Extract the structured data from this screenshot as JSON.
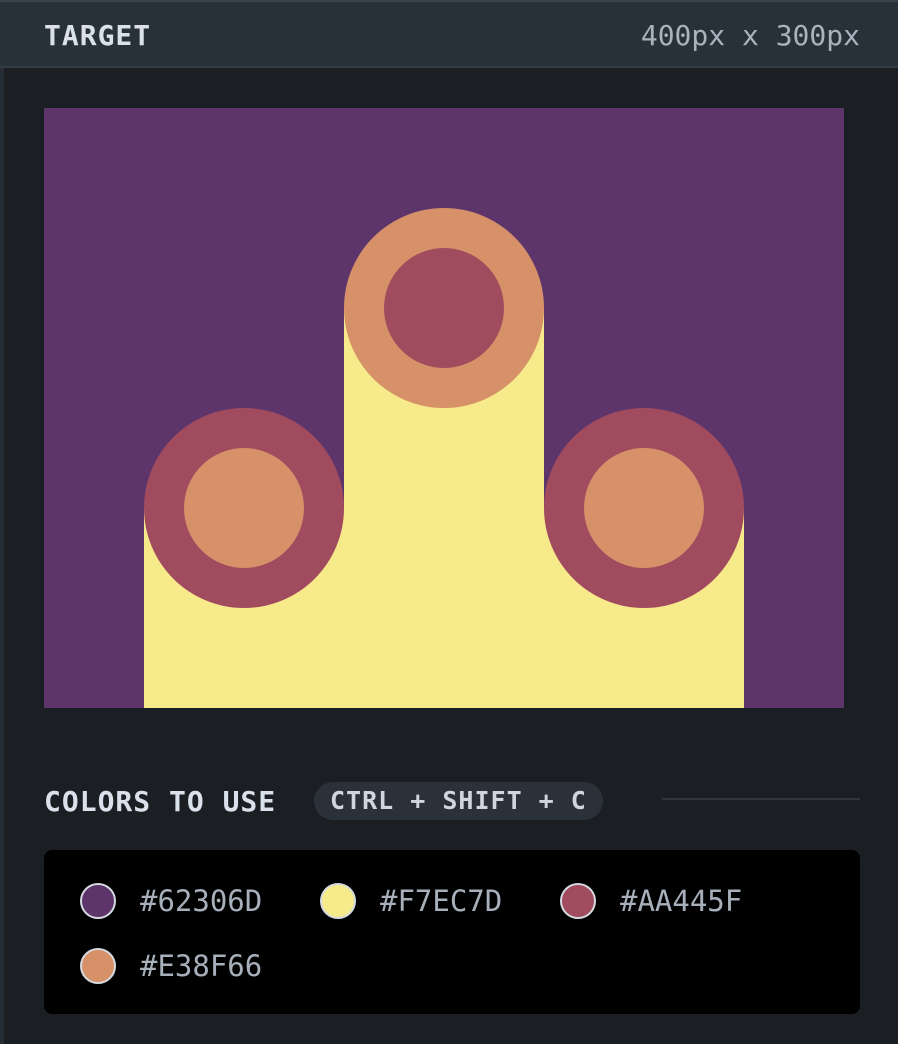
{
  "header": {
    "title": "TARGET",
    "size_label": "400px x 300px"
  },
  "target": {
    "background": "#5d356a",
    "shapes": {
      "pillar_color": "#f7ea8a",
      "outer_ring_color": "#d79168",
      "inner_center_color": "#a14b5f",
      "side_ring_color": "#a14b5f",
      "side_inner_color": "#d79168"
    }
  },
  "colors_section": {
    "label": "COLORS TO USE",
    "shortcut": "CTRL + SHIFT + C"
  },
  "palette": [
    {
      "hex": "#62306D",
      "color": "#5d356a"
    },
    {
      "hex": "#F7EC7D",
      "color": "#f7ea8a"
    },
    {
      "hex": "#AA445F",
      "color": "#a14b5f"
    },
    {
      "hex": "#E38F66",
      "color": "#d79168"
    }
  ]
}
